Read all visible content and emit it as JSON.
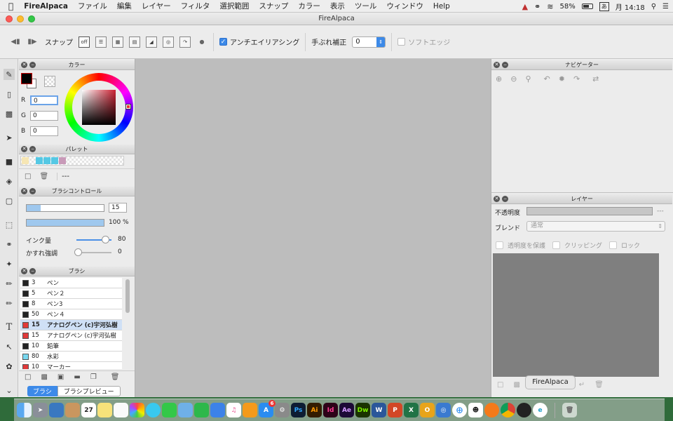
{
  "menubar": {
    "apple": "",
    "app_name": "FireAlpaca",
    "items": [
      "ファイル",
      "編集",
      "レイヤー",
      "フィルタ",
      "選択範囲",
      "スナップ",
      "カラー",
      "表示",
      "ツール",
      "ウィンドウ",
      "Help"
    ],
    "battery": "58%",
    "ime": "あ",
    "clock": "月 14:18"
  },
  "window": {
    "title": "FireAlpaca"
  },
  "toolbar": {
    "snap_label": "スナップ",
    "antialias_label": "アンチエイリアシング",
    "antialias_checked": true,
    "stabilizer_label": "手ぶれ補正",
    "stabilizer_value": "0",
    "soft_edge_label": "ソフトエッジ",
    "soft_edge_checked": false
  },
  "color_panel": {
    "title": "カラー",
    "r_label": "R",
    "r_value": "0",
    "g_label": "G",
    "g_value": "0",
    "b_label": "B",
    "b_value": "0",
    "primary_color": "#000000",
    "hue_color": "#cc2233"
  },
  "palette_panel": {
    "title": "パレット",
    "swatches": [
      "#f6e6b4",
      "#55c8e4",
      "#55c8e4",
      "#55c8e4",
      "#c89ab8"
    ],
    "placeholder": "---"
  },
  "brush_control": {
    "title": "ブラシコントロール",
    "size_value": "15",
    "opacity_value": "100 %",
    "ink_label": "インク量",
    "ink_value": "80",
    "blur_label": "かすれ強調",
    "blur_value": "0"
  },
  "brush_panel": {
    "title": "ブラシ",
    "items": [
      {
        "size": "3",
        "name": "ペン",
        "color": "#222222",
        "selected": false
      },
      {
        "size": "5",
        "name": "ペン２",
        "color": "#222222",
        "selected": false
      },
      {
        "size": "8",
        "name": "ペン3",
        "color": "#222222",
        "selected": false
      },
      {
        "size": "50",
        "name": "ペン４",
        "color": "#222222",
        "selected": false
      },
      {
        "size": "15",
        "name": "アナログペン (c)宇河弘樹",
        "color": "#e03a3a",
        "selected": true
      },
      {
        "size": "15",
        "name": "アナログペン (c)宇河弘樹",
        "color": "#e03a3a",
        "selected": false
      },
      {
        "size": "10",
        "name": "鉛筆",
        "color": "#222222",
        "selected": false
      },
      {
        "size": "80",
        "name": "水彩",
        "color": "#79d8f0",
        "selected": false
      },
      {
        "size": "10",
        "name": "マーカー",
        "color": "#e03a3a",
        "selected": false
      }
    ],
    "tab_brush": "ブラシ",
    "tab_preview": "ブラシプレビュー"
  },
  "navigator": {
    "title": "ナビゲーター"
  },
  "layer_panel": {
    "title": "レイヤー",
    "opacity_label": "不透明度",
    "opacity_value": "---",
    "blend_label": "ブレンド",
    "blend_value": "通常",
    "protect_label": "透明度を保護",
    "clipping_label": "クリッピング",
    "lock_label": "ロック"
  },
  "dock": {
    "tooltip": "FireAlpaca",
    "calendar_day": "27",
    "badge": "6",
    "labels": [
      "Ps",
      "Ai",
      "Id",
      "Ae",
      "Dw",
      "W",
      "P",
      "X",
      "O",
      "e"
    ]
  }
}
